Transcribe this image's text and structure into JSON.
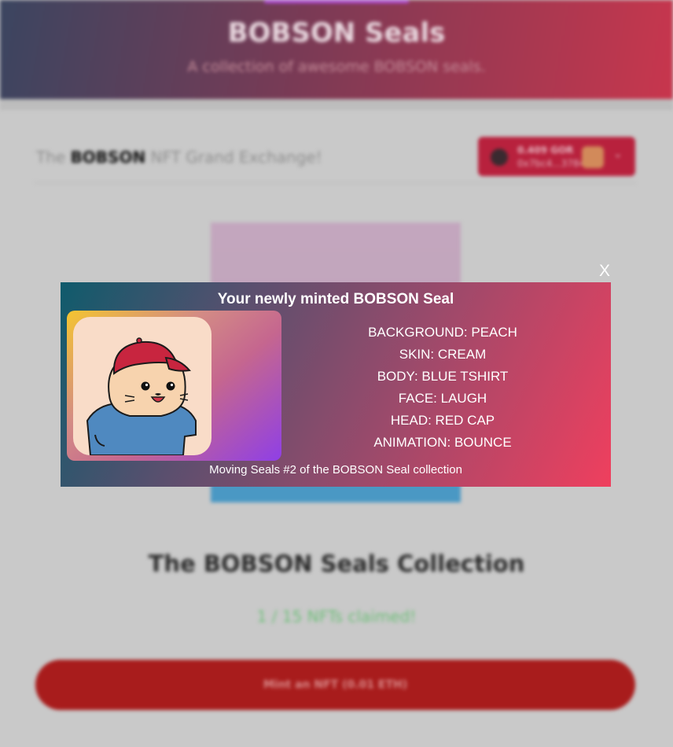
{
  "header": {
    "title": "BOBSON Seals",
    "subtitle": "A collection of awesome BOBSON seals."
  },
  "nav": {
    "brand_prefix": "The ",
    "brand_name": "BOBSON",
    "brand_suffix": " NFT Grand Exchange!"
  },
  "wallet": {
    "balance": "0.409 GOR",
    "address": "0x7bc4...3784"
  },
  "collection": {
    "title": "The BOBSON Seals Collection",
    "claimed": "1 / 15 NFTs claimed!",
    "mint_button": "Mint an NFT (0.01 ETH)"
  },
  "modal": {
    "close_label": "X",
    "title": "Your newly minted BOBSON Seal",
    "traits": [
      "BACKGROUND: PEACH",
      "SKIN: CREAM",
      "BODY: BLUE TSHIRT",
      "FACE: LAUGH",
      "HEAD: RED CAP",
      "ANIMATION: BOUNCE"
    ],
    "caption": "Moving Seals #2 of the BOBSON Seal collection"
  },
  "colors": {
    "accent": "#ef3f5e",
    "cap": "#c8253f",
    "shirt": "#4f89c0",
    "skin": "#f7d3ae"
  }
}
